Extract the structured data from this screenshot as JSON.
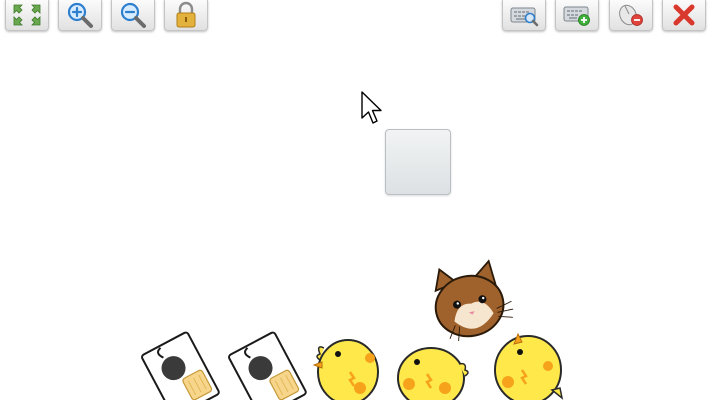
{
  "toolbar": {
    "left_buttons": [
      {
        "name": "fullscreen-button",
        "icon": "fullscreen-arrows-icon"
      },
      {
        "name": "zoom-in-button",
        "icon": "zoom-in-icon"
      },
      {
        "name": "zoom-out-button",
        "icon": "zoom-out-icon"
      },
      {
        "name": "lock-button",
        "icon": "padlock-icon"
      }
    ],
    "right_buttons": [
      {
        "name": "keyboard-search-button",
        "icon": "keyboard-search-icon"
      },
      {
        "name": "add-keyboard-button",
        "icon": "keyboard-add-icon"
      },
      {
        "name": "remove-mouse-button",
        "icon": "mouse-remove-icon"
      },
      {
        "name": "close-button",
        "icon": "close-x-icon"
      }
    ]
  },
  "sprites": [
    {
      "name": "cow-card-sprite-1",
      "kind": "cow-card"
    },
    {
      "name": "cow-card-sprite-2",
      "kind": "cow-card"
    },
    {
      "name": "chick-sprite-1",
      "kind": "chick"
    },
    {
      "name": "chick-sprite-2",
      "kind": "chick"
    },
    {
      "name": "cat-sprite",
      "kind": "cat"
    },
    {
      "name": "chick-sprite-3",
      "kind": "chick"
    }
  ],
  "colors": {
    "toolbar_face": "#eeeeee",
    "arrow_green": "#6aa84f",
    "magnifier_blue": "#2f7fcf",
    "lock_gold": "#d8a22a",
    "close_red": "#d9382c",
    "chick_yellow": "#ffe94a",
    "chick_orange": "#f7a21b",
    "cat_brown": "#a0622d"
  }
}
